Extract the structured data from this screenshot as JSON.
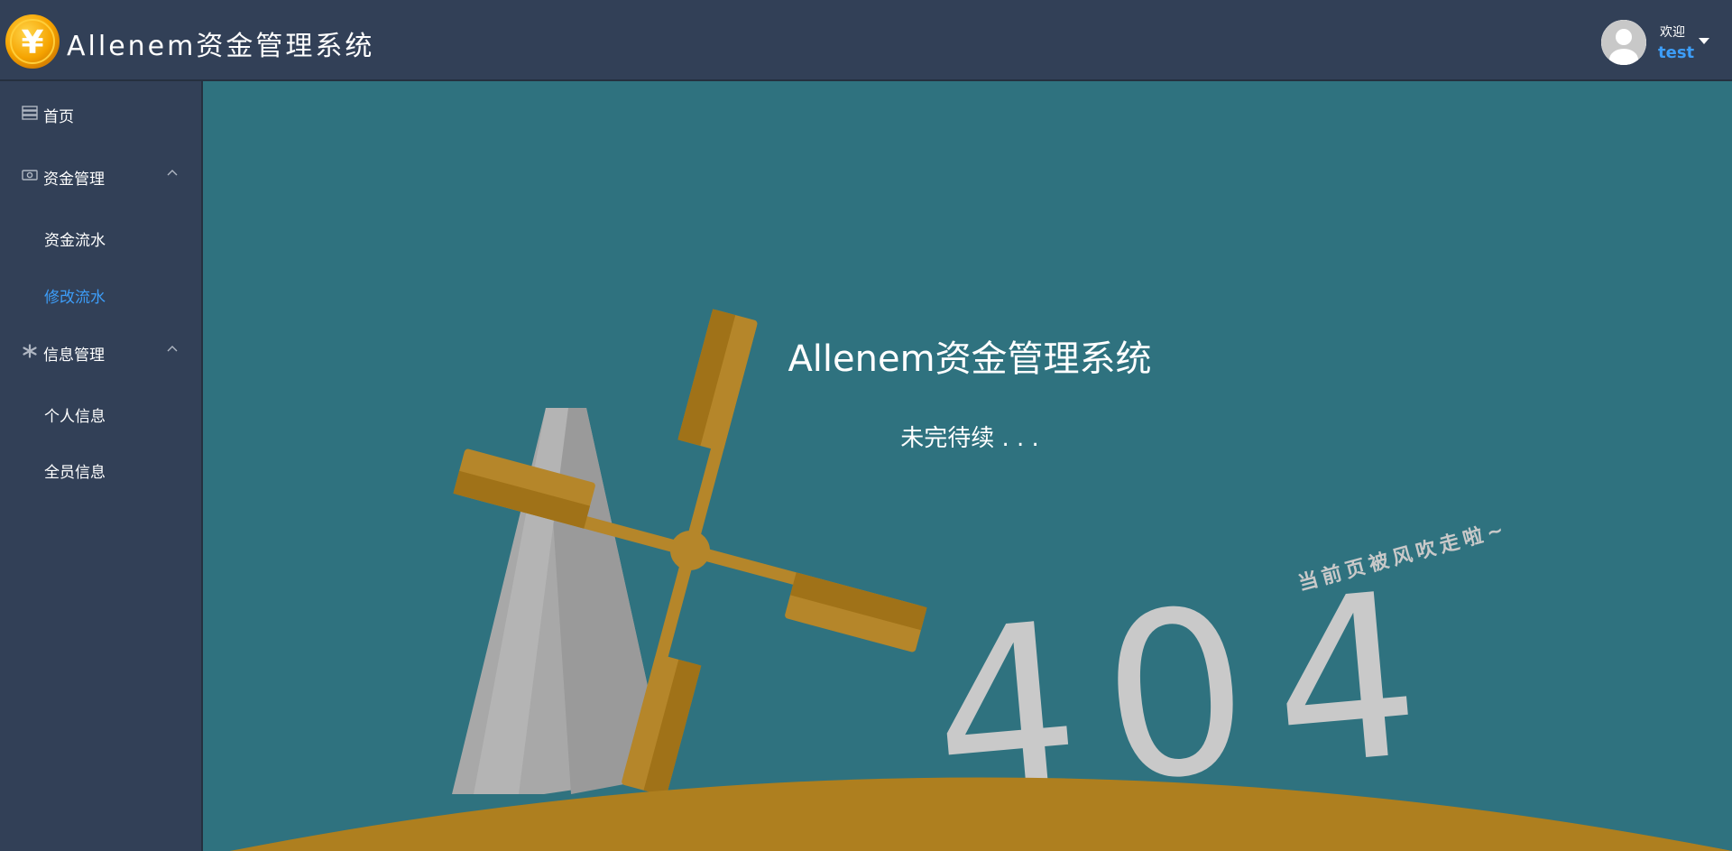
{
  "header": {
    "app_title": "Allenem资金管理系统",
    "logo_icon": "yen-coin-icon",
    "welcome_label": "欢迎",
    "username": "test",
    "caret_icon": "caret-down-icon"
  },
  "sidebar": {
    "items": [
      {
        "label": "首页",
        "icon": "server-icon"
      },
      {
        "label": "资金管理",
        "icon": "money-icon",
        "expanded": true,
        "children": [
          {
            "label": "资金流水",
            "active": false
          },
          {
            "label": "修改流水",
            "active": true
          }
        ]
      },
      {
        "label": "信息管理",
        "icon": "gear-icon",
        "expanded": true,
        "children": [
          {
            "label": "个人信息",
            "active": false
          },
          {
            "label": "全员信息",
            "active": false
          }
        ]
      }
    ]
  },
  "main": {
    "heading": "Allenem资金管理系统",
    "subheading": "未完待续 . . .",
    "error_code": "404",
    "error_caption": "当前页被风吹走啦~"
  },
  "colors": {
    "header_bg": "#324057",
    "sidebar_bg": "#324057",
    "main_bg": "#2f727f",
    "accent": "#3d9df8",
    "windmill_blade": "#b5862a",
    "ground": "#ae7f1f"
  }
}
